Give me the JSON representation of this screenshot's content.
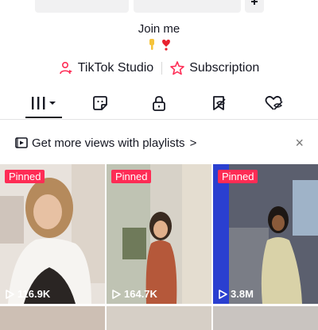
{
  "bio": {
    "text": "Join me",
    "emojis": [
      "hand-pointing-down-icon",
      "heart-exclamation-icon"
    ]
  },
  "links": [
    {
      "label": "TikTok Studio",
      "icon": "studio-person-icon"
    },
    {
      "label": "Subscription",
      "icon": "subscription-star-icon"
    }
  ],
  "tabs": [
    {
      "name": "videos-grid-tab",
      "icon": "grid-bars-icon",
      "selected": true
    },
    {
      "name": "sticker-tab",
      "icon": "sticker-icon",
      "selected": false
    },
    {
      "name": "private-tab",
      "icon": "lock-icon",
      "selected": false
    },
    {
      "name": "favorites-tab",
      "icon": "bookmark-hidden-icon",
      "selected": false
    },
    {
      "name": "liked-tab",
      "icon": "heart-hidden-icon",
      "selected": false
    }
  ],
  "promo": {
    "text": "Get more views with playlists",
    "chevron": ">",
    "close": "×"
  },
  "videos": [
    {
      "badge": "Pinned",
      "views": "116.9K"
    },
    {
      "badge": "Pinned",
      "views": "164.7K"
    },
    {
      "badge": "Pinned",
      "views": "3.8M"
    }
  ],
  "colors": {
    "accent": "#fe2c55",
    "text": "#161823",
    "secondary_text": "#757575"
  }
}
